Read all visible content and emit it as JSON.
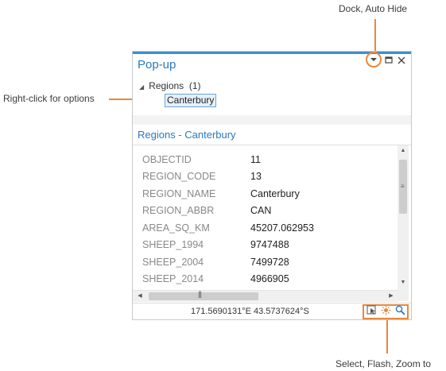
{
  "callouts": {
    "dock_autohide": "Dock, Auto Hide",
    "right_click": "Right-click for options",
    "select_flash_zoom": "Select, Flash, Zoom to"
  },
  "pane": {
    "title": "Pop-up",
    "tree": {
      "group_label": "Regions",
      "group_count": "(1)",
      "selected_item": "Canterbury"
    },
    "section_title": "Regions - Canterbury",
    "attributes": [
      {
        "name": "OBJECTID",
        "value": "11"
      },
      {
        "name": "REGION_CODE",
        "value": "13"
      },
      {
        "name": "REGION_NAME",
        "value": "Canterbury"
      },
      {
        "name": "REGION_ABBR",
        "value": "CAN"
      },
      {
        "name": "AREA_SQ_KM",
        "value": "45207.062953"
      },
      {
        "name": "SHEEP_1994",
        "value": "9747488"
      },
      {
        "name": "SHEEP_2004",
        "value": "7499728"
      },
      {
        "name": "SHEEP_2014",
        "value": "4966905"
      }
    ],
    "coordinates": "171.5690131°E 43.5737624°S"
  },
  "colors": {
    "accent": "#e8883a",
    "title_blue": "#2b78c0"
  },
  "icons": {
    "options": "chevron-down-icon",
    "maximize": "maximize-icon",
    "close": "close-icon",
    "select": "select-icon",
    "flash": "flash-icon",
    "zoom": "zoom-icon"
  }
}
